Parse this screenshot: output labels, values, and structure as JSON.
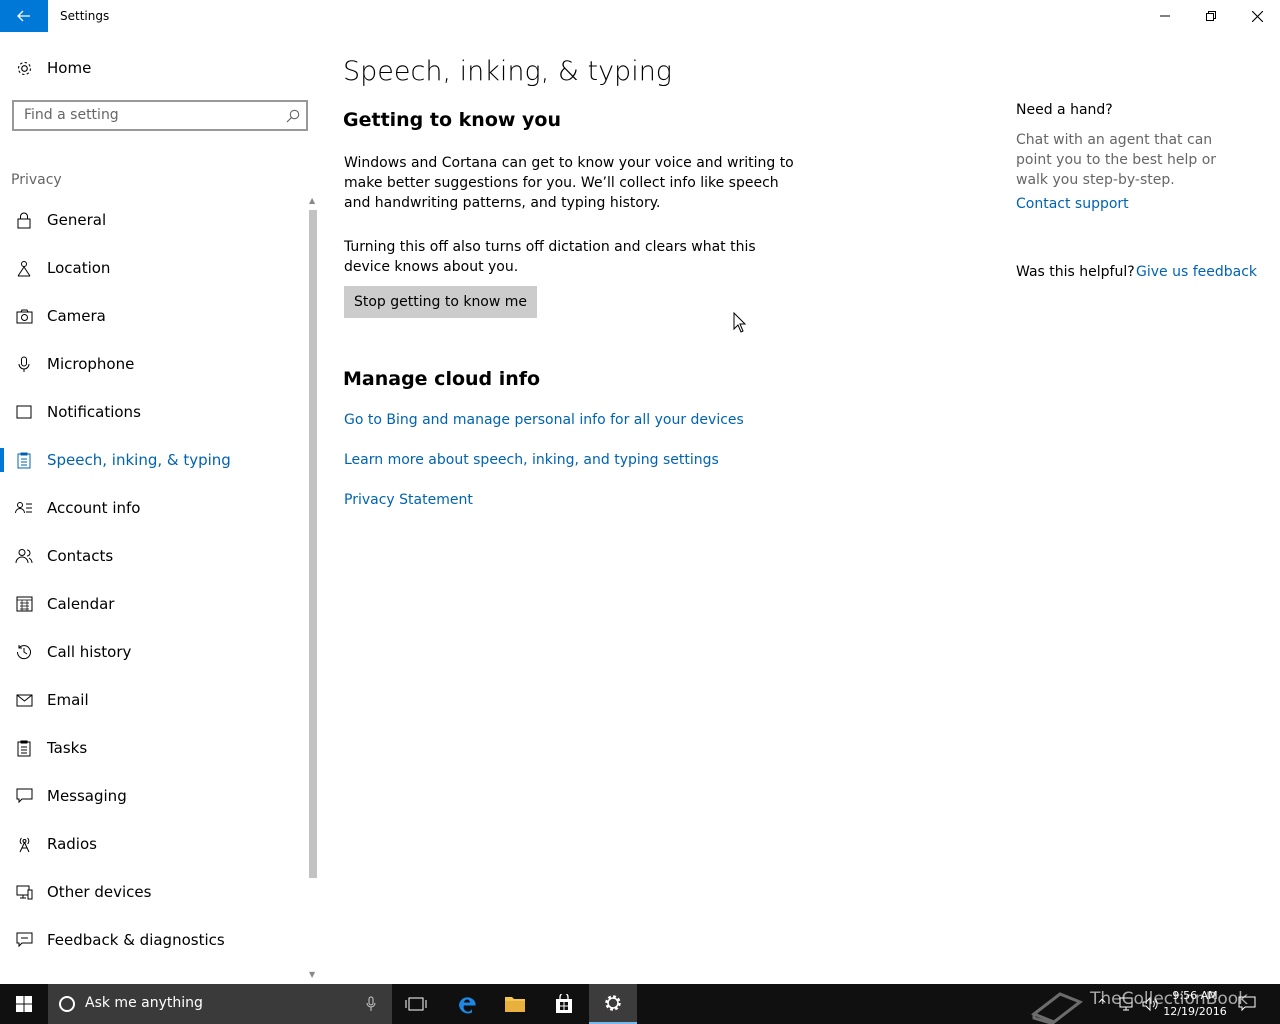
{
  "window": {
    "title": "Settings"
  },
  "sidebar": {
    "home_label": "Home",
    "search_placeholder": "Find a setting",
    "section_label": "Privacy",
    "items": [
      {
        "label": "General",
        "icon": "lock-icon"
      },
      {
        "label": "Location",
        "icon": "location-icon"
      },
      {
        "label": "Camera",
        "icon": "camera-icon"
      },
      {
        "label": "Microphone",
        "icon": "microphone-icon"
      },
      {
        "label": "Notifications",
        "icon": "notifications-icon"
      },
      {
        "label": "Speech, inking, & typing",
        "icon": "speech-icon",
        "active": true
      },
      {
        "label": "Account info",
        "icon": "account-info-icon"
      },
      {
        "label": "Contacts",
        "icon": "contacts-icon"
      },
      {
        "label": "Calendar",
        "icon": "calendar-icon"
      },
      {
        "label": "Call history",
        "icon": "history-icon"
      },
      {
        "label": "Email",
        "icon": "email-icon"
      },
      {
        "label": "Tasks",
        "icon": "tasks-icon"
      },
      {
        "label": "Messaging",
        "icon": "messaging-icon"
      },
      {
        "label": "Radios",
        "icon": "radio-icon"
      },
      {
        "label": "Other devices",
        "icon": "devices-icon"
      },
      {
        "label": "Feedback & diagnostics",
        "icon": "feedback-icon"
      }
    ]
  },
  "main": {
    "page_title": "Speech, inking, & typing",
    "section1_heading": "Getting to know you",
    "section1_para1": "Windows and Cortana can get to know your voice and writing to make better suggestions for you. We’ll collect info like speech and handwriting patterns, and typing history.",
    "section1_para2": "Turning this off also turns off dictation and clears what this device knows about you.",
    "stop_button_label": "Stop getting to know me",
    "section2_heading": "Manage cloud info",
    "link_bing": "Go to Bing and manage personal info for all your devices",
    "link_learn_more": "Learn more about speech, inking, and typing settings",
    "link_privacy": "Privacy Statement"
  },
  "aside": {
    "heading": "Need a hand?",
    "text": "Chat with an agent that can point you to the best help or walk you step-by-step.",
    "contact_link": "Contact support",
    "helpful_question": "Was this helpful?",
    "feedback_link": "Give us feedback"
  },
  "taskbar": {
    "search_placeholder": "Ask me anything",
    "time": "9:56 AM",
    "date": "12/19/2016",
    "watermark_text": "TheCollectionBook"
  },
  "colors": {
    "accent": "#0078d7",
    "link": "#0063b1",
    "taskbar": "#101010"
  }
}
